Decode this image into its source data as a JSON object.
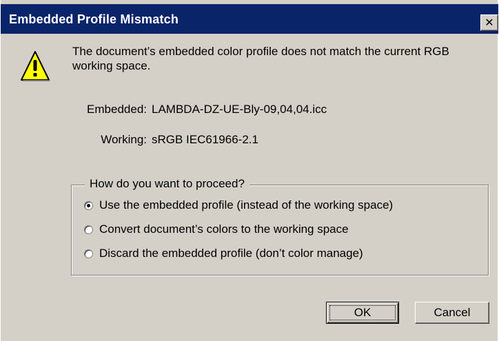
{
  "dialog": {
    "title": "Embedded Profile Mismatch",
    "close_glyph": "✕",
    "icon": "warning-icon",
    "message": "The document’s embedded color profile does not match the current RGB working space.",
    "embedded_label": "Embedded:",
    "embedded_value": "LAMBDA-DZ-UE-Bly-09,04,04.icc",
    "working_label": "Working:",
    "working_value": "sRGB IEC61966-2.1",
    "group": {
      "legend": "How do you want to proceed?",
      "options": [
        {
          "label": "Use the embedded profile (instead of the working space)",
          "checked": true
        },
        {
          "label": "Convert document’s colors to the working space",
          "checked": false
        },
        {
          "label": "Discard the embedded profile (don’t color manage)",
          "checked": false
        }
      ]
    },
    "buttons": {
      "ok_label": "OK",
      "cancel_label": "Cancel"
    }
  },
  "colors": {
    "titlebar": "#0a246a",
    "face": "#d4d0c8",
    "warning_yellow": "#ffff00"
  }
}
